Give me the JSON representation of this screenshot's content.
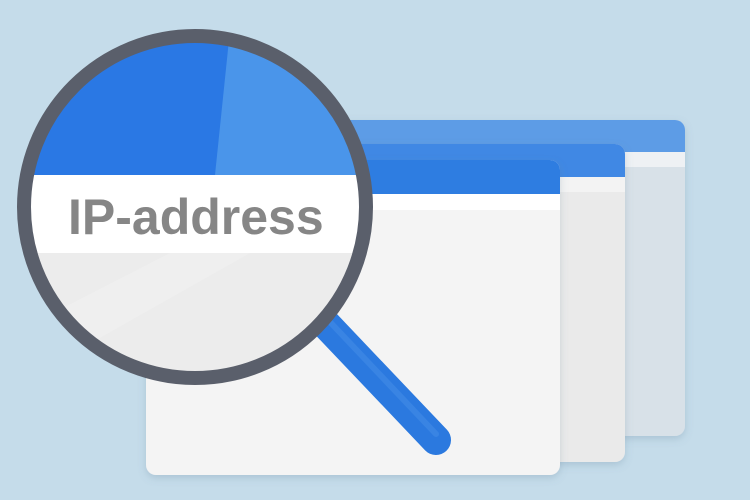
{
  "illustration": {
    "magnifier_text": "IP-address",
    "icon": "magnifier-over-browser-windows-icon"
  },
  "colors": {
    "background": "#c5dcea",
    "window_fill_front": "#f4f4f4",
    "window_fill_middle": "#eaeaea",
    "window_fill_back": "#d8e1e8",
    "window_titlebar": "#2f7de1",
    "window_titlebar_back": "#5d9ce6",
    "magnifier_ring": "#5a5f6b",
    "lens_blue": "#2a78e4",
    "lens_blue_light": "#4a95ea",
    "lens_gray": "#ececec",
    "handle": "#2b79df",
    "text": "#868686"
  }
}
